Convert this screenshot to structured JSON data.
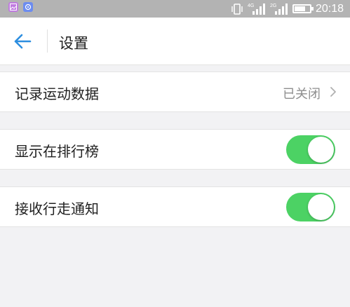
{
  "status_bar": {
    "time": "20:18",
    "network_labels": [
      "4G",
      "2G"
    ],
    "icons": [
      "gallery-icon",
      "app-icon",
      "vibrate-icon",
      "signal-icon",
      "signal-icon",
      "battery-charging-icon"
    ]
  },
  "header": {
    "title": "设置",
    "back_icon": "arrow-left-icon",
    "accent_color": "#2d8ee0"
  },
  "settings": {
    "record_data": {
      "label": "记录运动数据",
      "value": "已关闭"
    },
    "show_ranking": {
      "label": "显示在排行榜",
      "enabled": true
    },
    "receive_notifications": {
      "label": "接收行走通知",
      "enabled": true
    }
  },
  "colors": {
    "toggle_on": "#4cd264",
    "background": "#f2f2f4"
  }
}
